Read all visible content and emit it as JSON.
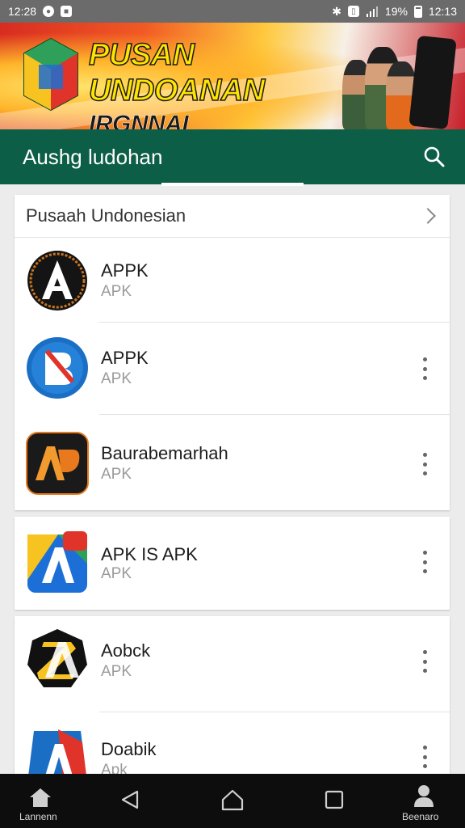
{
  "status_bar": {
    "time": "12:28",
    "battery": "19%",
    "clock_right": "12:13",
    "left_icons": [
      "notification-icon",
      "message-icon"
    ],
    "right_icons": [
      "bluetooth-icon",
      "vibrate-icon",
      "signal-icon",
      "battery-icon"
    ]
  },
  "banner": {
    "line1": "PUSAN UNDOANAN",
    "line2": "IRGNNAI UTBUAINAA!"
  },
  "app_bar": {
    "title": "Aushg ludohan",
    "search_icon": "search-icon"
  },
  "section": {
    "header": "Pusaah Undonesian"
  },
  "apps": [
    {
      "name": "APPK",
      "sub": "APK"
    },
    {
      "name": "APPK",
      "sub": "APK"
    },
    {
      "name": "Baurabemarhah",
      "sub": "APK"
    },
    {
      "name": "APK IS APK",
      "sub": "APK"
    },
    {
      "name": "Aobck",
      "sub": "APK"
    },
    {
      "name": "Doabik",
      "sub": "Apk"
    }
  ],
  "nav_bar": {
    "left_label": "Lannenn",
    "right_label": "Beenaro"
  },
  "colors": {
    "app_bar": "#0d5e46",
    "nav_bar": "#0d0d0d",
    "status_bar": "#6b6b6b"
  }
}
